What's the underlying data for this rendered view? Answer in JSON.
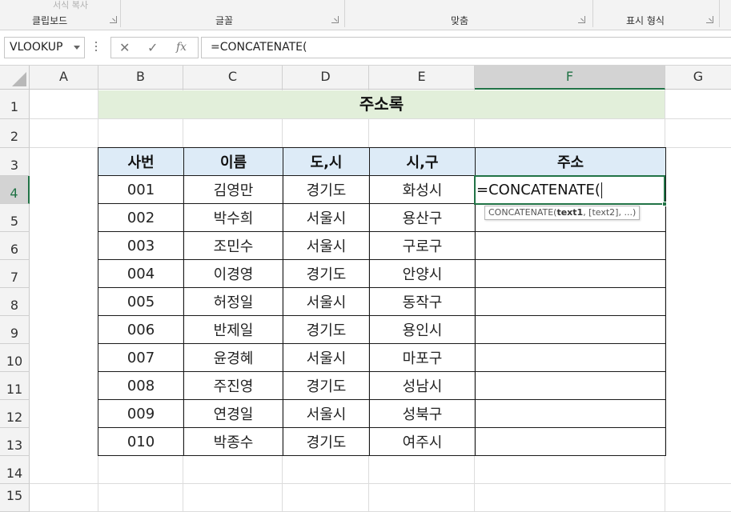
{
  "ribbon": {
    "ghost_label": "서식 복사",
    "groups": [
      "클립보드",
      "글꼴",
      "맞춤",
      "표시 형식"
    ]
  },
  "formula_bar": {
    "name_box": "VLOOKUP",
    "cancel_icon": "x-icon",
    "enter_icon": "checkmark-icon",
    "function_icon": "fx",
    "formula": "=CONCATENATE("
  },
  "columns": [
    "A",
    "B",
    "C",
    "D",
    "E",
    "F",
    "G"
  ],
  "rows": [
    "1",
    "2",
    "3",
    "4",
    "5",
    "6",
    "7",
    "8",
    "9",
    "10",
    "11",
    "12",
    "13",
    "14",
    "15"
  ],
  "selected_column": "F",
  "selected_row": "4",
  "sheet": {
    "title": "주소록",
    "headers": [
      "사번",
      "이름",
      "도,시",
      "시,구",
      "주소"
    ],
    "records": [
      [
        "001",
        "김영만",
        "경기도",
        "화성시",
        ""
      ],
      [
        "002",
        "박수희",
        "서울시",
        "용산구",
        ""
      ],
      [
        "003",
        "조민수",
        "서울시",
        "구로구",
        ""
      ],
      [
        "004",
        "이경영",
        "경기도",
        "안양시",
        ""
      ],
      [
        "005",
        "허정일",
        "서울시",
        "동작구",
        ""
      ],
      [
        "006",
        "반제일",
        "경기도",
        "용인시",
        ""
      ],
      [
        "007",
        "윤경혜",
        "서울시",
        "마포구",
        ""
      ],
      [
        "008",
        "주진영",
        "경기도",
        "성남시",
        ""
      ],
      [
        "009",
        "연경일",
        "서울시",
        "성북구",
        ""
      ],
      [
        "010",
        "박종수",
        "경기도",
        "여주시",
        ""
      ]
    ]
  },
  "active_cell": {
    "editing_text": "=CONCATENATE(",
    "tooltip_func": "CONCATENATE(",
    "tooltip_arg1": "text1",
    "tooltip_rest": ", [text2], ...)"
  },
  "colors": {
    "accent": "#217346",
    "title_band": "#e2efda",
    "header_fill": "#ddebf7"
  }
}
